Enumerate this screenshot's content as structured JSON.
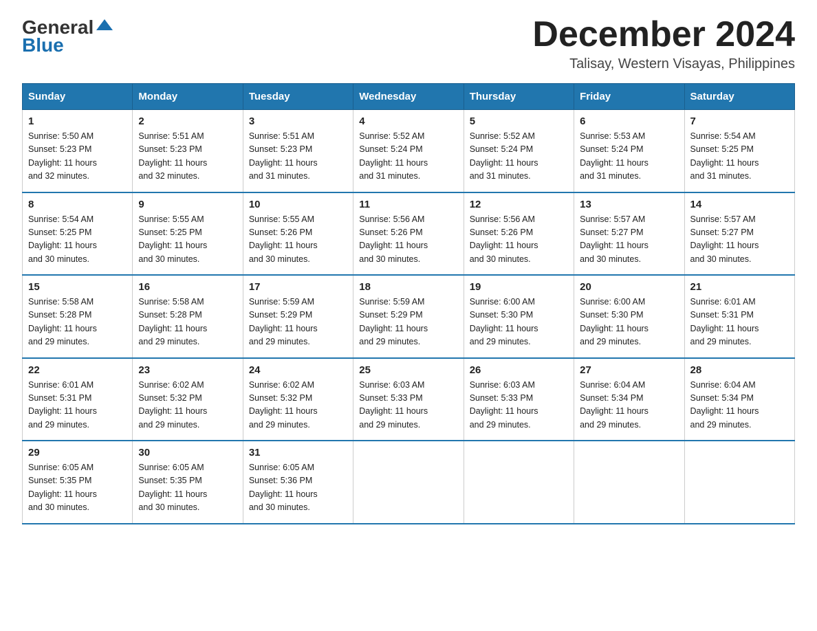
{
  "header": {
    "logo_general": "General",
    "logo_blue": "Blue",
    "month_title": "December 2024",
    "location": "Talisay, Western Visayas, Philippines"
  },
  "days_of_week": [
    "Sunday",
    "Monday",
    "Tuesday",
    "Wednesday",
    "Thursday",
    "Friday",
    "Saturday"
  ],
  "weeks": [
    [
      {
        "day": "1",
        "sunrise": "5:50 AM",
        "sunset": "5:23 PM",
        "daylight": "11 hours and 32 minutes."
      },
      {
        "day": "2",
        "sunrise": "5:51 AM",
        "sunset": "5:23 PM",
        "daylight": "11 hours and 32 minutes."
      },
      {
        "day": "3",
        "sunrise": "5:51 AM",
        "sunset": "5:23 PM",
        "daylight": "11 hours and 31 minutes."
      },
      {
        "day": "4",
        "sunrise": "5:52 AM",
        "sunset": "5:24 PM",
        "daylight": "11 hours and 31 minutes."
      },
      {
        "day": "5",
        "sunrise": "5:52 AM",
        "sunset": "5:24 PM",
        "daylight": "11 hours and 31 minutes."
      },
      {
        "day": "6",
        "sunrise": "5:53 AM",
        "sunset": "5:24 PM",
        "daylight": "11 hours and 31 minutes."
      },
      {
        "day": "7",
        "sunrise": "5:54 AM",
        "sunset": "5:25 PM",
        "daylight": "11 hours and 31 minutes."
      }
    ],
    [
      {
        "day": "8",
        "sunrise": "5:54 AM",
        "sunset": "5:25 PM",
        "daylight": "11 hours and 30 minutes."
      },
      {
        "day": "9",
        "sunrise": "5:55 AM",
        "sunset": "5:25 PM",
        "daylight": "11 hours and 30 minutes."
      },
      {
        "day": "10",
        "sunrise": "5:55 AM",
        "sunset": "5:26 PM",
        "daylight": "11 hours and 30 minutes."
      },
      {
        "day": "11",
        "sunrise": "5:56 AM",
        "sunset": "5:26 PM",
        "daylight": "11 hours and 30 minutes."
      },
      {
        "day": "12",
        "sunrise": "5:56 AM",
        "sunset": "5:26 PM",
        "daylight": "11 hours and 30 minutes."
      },
      {
        "day": "13",
        "sunrise": "5:57 AM",
        "sunset": "5:27 PM",
        "daylight": "11 hours and 30 minutes."
      },
      {
        "day": "14",
        "sunrise": "5:57 AM",
        "sunset": "5:27 PM",
        "daylight": "11 hours and 30 minutes."
      }
    ],
    [
      {
        "day": "15",
        "sunrise": "5:58 AM",
        "sunset": "5:28 PM",
        "daylight": "11 hours and 29 minutes."
      },
      {
        "day": "16",
        "sunrise": "5:58 AM",
        "sunset": "5:28 PM",
        "daylight": "11 hours and 29 minutes."
      },
      {
        "day": "17",
        "sunrise": "5:59 AM",
        "sunset": "5:29 PM",
        "daylight": "11 hours and 29 minutes."
      },
      {
        "day": "18",
        "sunrise": "5:59 AM",
        "sunset": "5:29 PM",
        "daylight": "11 hours and 29 minutes."
      },
      {
        "day": "19",
        "sunrise": "6:00 AM",
        "sunset": "5:30 PM",
        "daylight": "11 hours and 29 minutes."
      },
      {
        "day": "20",
        "sunrise": "6:00 AM",
        "sunset": "5:30 PM",
        "daylight": "11 hours and 29 minutes."
      },
      {
        "day": "21",
        "sunrise": "6:01 AM",
        "sunset": "5:31 PM",
        "daylight": "11 hours and 29 minutes."
      }
    ],
    [
      {
        "day": "22",
        "sunrise": "6:01 AM",
        "sunset": "5:31 PM",
        "daylight": "11 hours and 29 minutes."
      },
      {
        "day": "23",
        "sunrise": "6:02 AM",
        "sunset": "5:32 PM",
        "daylight": "11 hours and 29 minutes."
      },
      {
        "day": "24",
        "sunrise": "6:02 AM",
        "sunset": "5:32 PM",
        "daylight": "11 hours and 29 minutes."
      },
      {
        "day": "25",
        "sunrise": "6:03 AM",
        "sunset": "5:33 PM",
        "daylight": "11 hours and 29 minutes."
      },
      {
        "day": "26",
        "sunrise": "6:03 AM",
        "sunset": "5:33 PM",
        "daylight": "11 hours and 29 minutes."
      },
      {
        "day": "27",
        "sunrise": "6:04 AM",
        "sunset": "5:34 PM",
        "daylight": "11 hours and 29 minutes."
      },
      {
        "day": "28",
        "sunrise": "6:04 AM",
        "sunset": "5:34 PM",
        "daylight": "11 hours and 29 minutes."
      }
    ],
    [
      {
        "day": "29",
        "sunrise": "6:05 AM",
        "sunset": "5:35 PM",
        "daylight": "11 hours and 30 minutes."
      },
      {
        "day": "30",
        "sunrise": "6:05 AM",
        "sunset": "5:35 PM",
        "daylight": "11 hours and 30 minutes."
      },
      {
        "day": "31",
        "sunrise": "6:05 AM",
        "sunset": "5:36 PM",
        "daylight": "11 hours and 30 minutes."
      },
      null,
      null,
      null,
      null
    ]
  ],
  "sunrise_label": "Sunrise:",
  "sunset_label": "Sunset:",
  "daylight_label": "Daylight:"
}
